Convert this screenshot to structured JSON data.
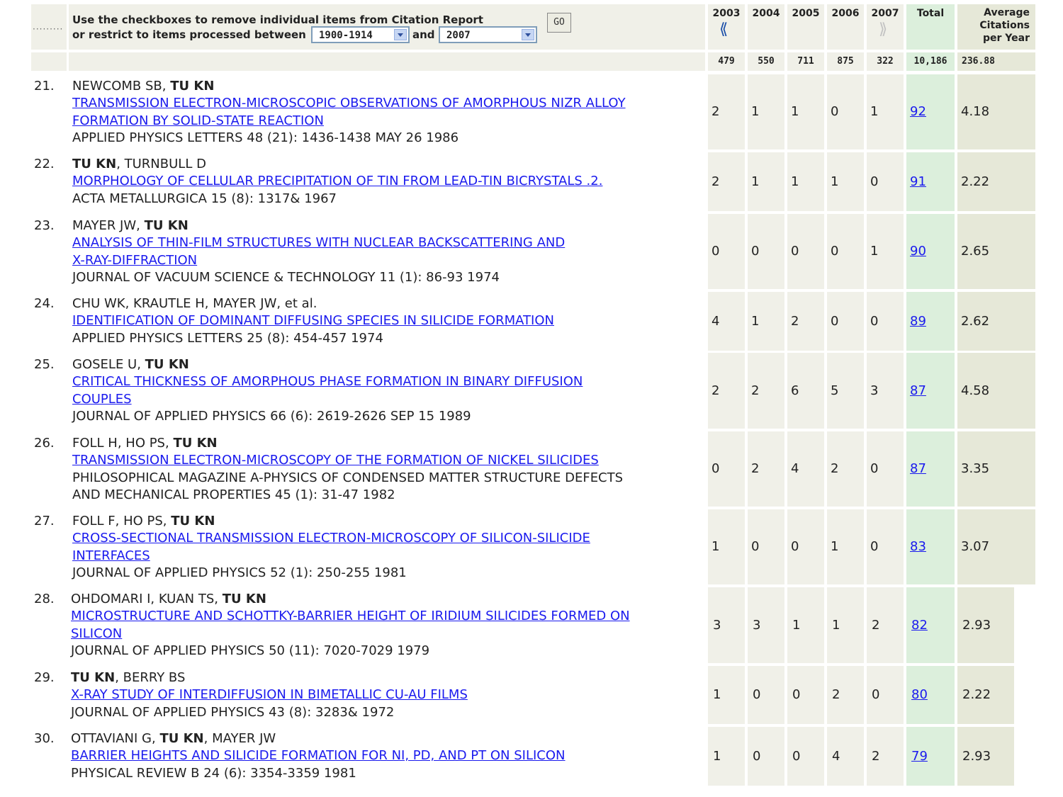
{
  "controls": {
    "line1": "Use the checkboxes to remove individual items from Citation Report",
    "line2": "or restrict to items processed between",
    "from_value": "1900-1914",
    "and_label": "and",
    "to_value": "2007",
    "go_label": "GO"
  },
  "columns": {
    "years": [
      "2003",
      "2004",
      "2005",
      "2006",
      "2007"
    ],
    "total_label": "Total",
    "avg_l1": "Average",
    "avg_l2": "Citations",
    "avg_l3": "per Year"
  },
  "totals": {
    "years": [
      "479",
      "550",
      "711",
      "875",
      "322"
    ],
    "total": "10,186",
    "avg": "236.88"
  },
  "records": [
    {
      "num": "21.",
      "authors": [
        {
          "t": "NEWCOMB SB, ",
          "b": false
        },
        {
          "t": "TU KN",
          "b": true
        }
      ],
      "title": [
        "TRANSMISSION ELECTRON-MICROSCOPIC OBSERVATIONS OF AMORPHOUS NIZR ALLOY",
        "FORMATION BY SOLID-STATE REACTION"
      ],
      "source": [
        "APPLIED PHYSICS LETTERS 48 (21): 1436-1438 MAY 26 1986"
      ],
      "counts": [
        "2",
        "1",
        "1",
        "0",
        "1"
      ],
      "total": "92",
      "avg": "4.18"
    },
    {
      "num": "22.",
      "authors": [
        {
          "t": "TU KN",
          "b": true
        },
        {
          "t": ", TURNBULL D",
          "b": false
        }
      ],
      "title": [
        "MORPHOLOGY OF CELLULAR PRECIPITATION OF TIN FROM LEAD-TIN BICRYSTALS .2."
      ],
      "source": [
        "ACTA METALLURGICA 15 (8): 1317& 1967"
      ],
      "counts": [
        "2",
        "1",
        "1",
        "1",
        "0"
      ],
      "total": "91",
      "avg": "2.22"
    },
    {
      "num": "23.",
      "authors": [
        {
          "t": "MAYER JW, ",
          "b": false
        },
        {
          "t": "TU KN",
          "b": true
        }
      ],
      "title": [
        "ANALYSIS OF THIN-FILM STRUCTURES WITH NUCLEAR BACKSCATTERING AND",
        "X-RAY-DIFFRACTION"
      ],
      "source": [
        "JOURNAL OF VACUUM SCIENCE & TECHNOLOGY 11 (1): 86-93 1974"
      ],
      "counts": [
        "0",
        "0",
        "0",
        "0",
        "1"
      ],
      "total": "90",
      "avg": "2.65"
    },
    {
      "num": "24.",
      "authors": [
        {
          "t": "CHU WK, KRAUTLE H, MAYER JW, et al.",
          "b": false
        }
      ],
      "title": [
        "IDENTIFICATION OF DOMINANT DIFFUSING SPECIES IN SILICIDE FORMATION"
      ],
      "source": [
        "APPLIED PHYSICS LETTERS 25 (8): 454-457 1974"
      ],
      "counts": [
        "4",
        "1",
        "2",
        "0",
        "0"
      ],
      "total": "89",
      "avg": "2.62"
    },
    {
      "num": "25.",
      "authors": [
        {
          "t": "GOSELE U, ",
          "b": false
        },
        {
          "t": "TU KN",
          "b": true
        }
      ],
      "title": [
        "CRITICAL THICKNESS OF AMORPHOUS PHASE FORMATION IN BINARY DIFFUSION",
        "COUPLES"
      ],
      "source": [
        "JOURNAL OF APPLIED PHYSICS 66 (6): 2619-2626 SEP 15 1989"
      ],
      "counts": [
        "2",
        "2",
        "6",
        "5",
        "3"
      ],
      "total": "87",
      "avg": "4.58"
    },
    {
      "num": "26.",
      "authors": [
        {
          "t": "FOLL H, HO PS, ",
          "b": false
        },
        {
          "t": "TU KN",
          "b": true
        }
      ],
      "title": [
        "TRANSMISSION ELECTRON-MICROSCOPY OF THE FORMATION OF NICKEL SILICIDES"
      ],
      "source": [
        "PHILOSOPHICAL MAGAZINE A-PHYSICS OF CONDENSED MATTER STRUCTURE DEFECTS",
        "AND MECHANICAL PROPERTIES 45 (1): 31-47 1982"
      ],
      "counts": [
        "0",
        "2",
        "4",
        "2",
        "0"
      ],
      "total": "87",
      "avg": "3.35"
    },
    {
      "num": "27.",
      "authors": [
        {
          "t": "FOLL F, HO PS, ",
          "b": false
        },
        {
          "t": "TU KN",
          "b": true
        }
      ],
      "title": [
        "CROSS-SECTIONAL TRANSMISSION ELECTRON-MICROSCOPY OF SILICON-SILICIDE",
        "INTERFACES"
      ],
      "source": [
        "JOURNAL OF APPLIED PHYSICS 52 (1): 250-255 1981"
      ],
      "counts": [
        "1",
        "0",
        "0",
        "1",
        "0"
      ],
      "total": "83",
      "avg": "3.07"
    },
    {
      "num": "28.",
      "authors": [
        {
          "t": "OHDOMARI I, KUAN TS, ",
          "b": false
        },
        {
          "t": "TU KN",
          "b": true
        }
      ],
      "title": [
        "MICROSTRUCTURE AND SCHOTTKY-BARRIER HEIGHT OF IRIDIUM SILICIDES FORMED ON",
        "SILICON"
      ],
      "source": [
        "JOURNAL OF APPLIED PHYSICS 50 (11): 7020-7029 1979"
      ],
      "counts": [
        "3",
        "3",
        "1",
        "1",
        "2"
      ],
      "total": "82",
      "avg": "2.93"
    },
    {
      "num": "29.",
      "authors": [
        {
          "t": "TU KN",
          "b": true
        },
        {
          "t": ", BERRY BS",
          "b": false
        }
      ],
      "title": [
        "X-RAY STUDY OF INTERDIFFUSION IN BIMETALLIC CU-AU FILMS"
      ],
      "source": [
        "JOURNAL OF APPLIED PHYSICS 43 (8): 3283& 1972"
      ],
      "counts": [
        "1",
        "0",
        "0",
        "2",
        "0"
      ],
      "total": "80",
      "avg": "2.22"
    },
    {
      "num": "30.",
      "authors": [
        {
          "t": "OTTAVIANI G, ",
          "b": false
        },
        {
          "t": "TU KN",
          "b": true
        },
        {
          "t": ", MAYER JW",
          "b": false
        }
      ],
      "title": [
        "BARRIER HEIGHTS AND SILICIDE FORMATION FOR NI, PD, AND PT ON SILICON"
      ],
      "source": [
        "PHYSICAL REVIEW B 24 (6): 3354-3359 1981"
      ],
      "counts": [
        "1",
        "0",
        "0",
        "4",
        "2"
      ],
      "total": "79",
      "avg": "2.93"
    }
  ]
}
